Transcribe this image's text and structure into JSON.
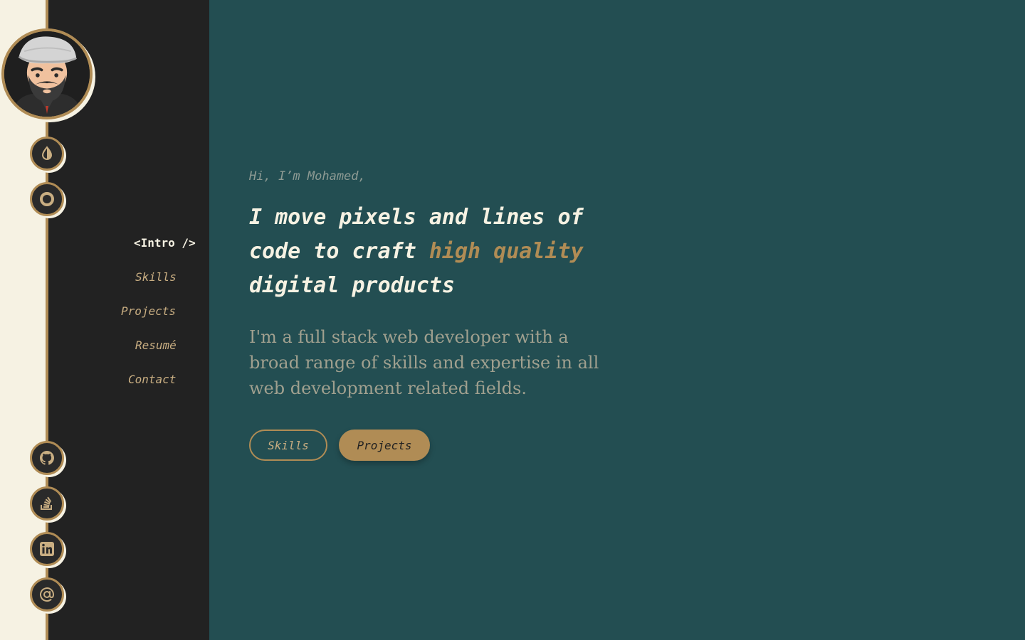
{
  "nav": {
    "items": [
      {
        "label": "<Intro />",
        "active": true
      },
      {
        "label": "Skills",
        "active": false
      },
      {
        "label": "Projects",
        "active": false
      },
      {
        "label": "Resumé",
        "active": false
      },
      {
        "label": "Contact",
        "active": false
      }
    ]
  },
  "controls": {
    "theme_icon": "contrast-icon",
    "mode_icon": "ring-icon"
  },
  "social": {
    "icons": [
      "github-icon",
      "stackoverflow-icon",
      "linkedin-icon",
      "at-sign-icon"
    ]
  },
  "hero": {
    "greeting": "Hi, I’m Mohamed,",
    "headline_part1": "I move pixels and lines of code to craft ",
    "headline_accent": "high quality",
    "headline_part2": " digital products",
    "description": "I'm a full stack web developer with a broad range of skills and expertise in all web development related fields.",
    "btn_skills": "Skills",
    "btn_projects": "Projects"
  },
  "colors": {
    "accent": "#b08c55",
    "cream": "#f6f2e3",
    "sidebar_bg": "#222222",
    "main_bg": "#234e52"
  }
}
